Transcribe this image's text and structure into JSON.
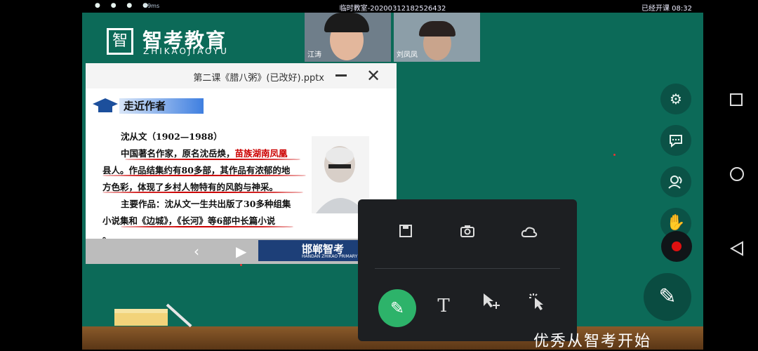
{
  "status_bar": {
    "dots": "● ● ● ●",
    "ping": "59ms",
    "title": "临时教室-20200312182526432",
    "status": "已经开课",
    "time": "08:32"
  },
  "logo": {
    "mark": "智",
    "cn": "智考教育",
    "en": "ZHIKAOJIAOYU"
  },
  "videos": [
    {
      "name": "江涛"
    },
    {
      "name": "刘凤凤"
    }
  ],
  "ppt": {
    "title": "第二课《腊八粥》(已改好).pptx",
    "section": "走近作者",
    "lines": [
      "沈从文（1902—1988）",
      "中国著名作家，原名沈岳焕，",
      "苗族湖南凤凰",
      "县人。作品结集约有80多部，其作品有浓郁的地",
      "方色彩，体现了乡村人物特有的风韵与神采。",
      "主要作品：沈从文一生共出版了30多种组集",
      "小说集和《边城》，《长河》等6部中长篇小说",
      "。"
    ],
    "brand": "邯郸智考",
    "brand_en": "HANDAN ZHIKAO PRIMARY"
  },
  "slogan": "优秀从智考开始",
  "icons": {
    "save": "save-icon",
    "camera": "camera-icon",
    "cloud": "cloud-icon",
    "pen": "pen-icon",
    "text": "text-icon",
    "move": "select-move-icon",
    "laser": "laser-pointer-icon",
    "settings": "gear-icon",
    "chat": "chat-icon",
    "members": "members-icon",
    "hand": "raise-hand-icon"
  },
  "colors": {
    "board": "#0c6a58",
    "accent_green": "#2db36a",
    "record": "#e01010"
  }
}
